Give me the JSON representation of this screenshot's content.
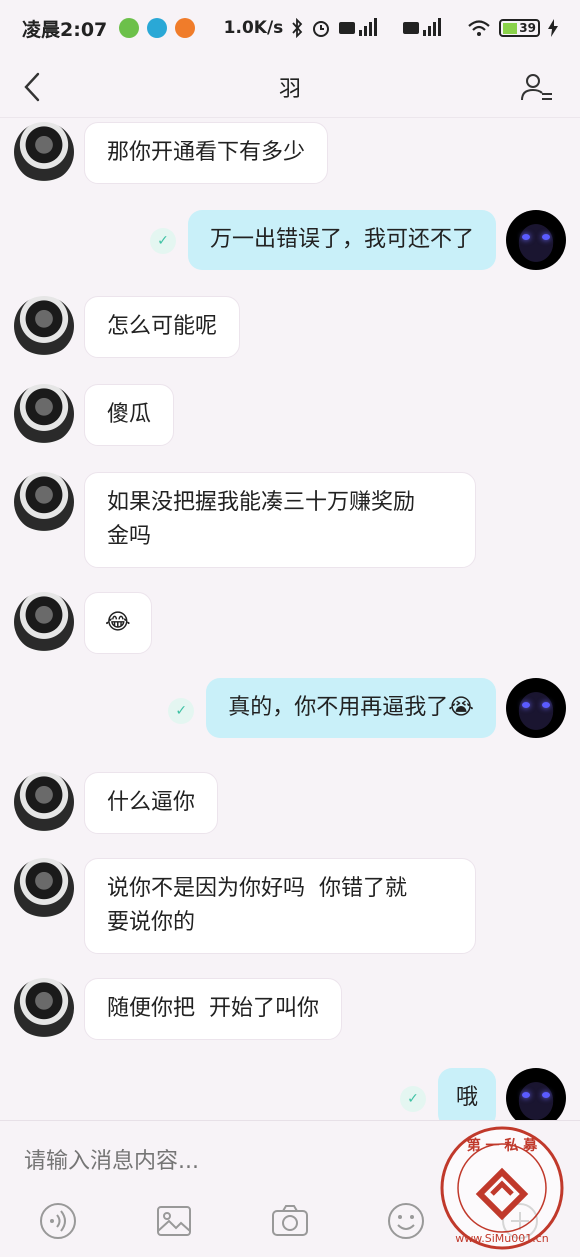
{
  "status": {
    "time": "凌晨2:07",
    "speed": "1.0K/s",
    "battery": "39"
  },
  "header": {
    "title": "羽"
  },
  "messages": [
    {
      "side": "in",
      "text": "那你开通看下有多少"
    },
    {
      "side": "out",
      "text": "万一出错误了，我可还不了"
    },
    {
      "side": "in",
      "text": "怎么可能呢"
    },
    {
      "side": "in",
      "text": "傻瓜"
    },
    {
      "side": "in",
      "text": "如果没把握我能凑三十万赚奖励\n金吗"
    },
    {
      "side": "in",
      "text": "😂"
    },
    {
      "side": "out",
      "text": "真的，你不用再逼我了😭"
    },
    {
      "side": "in",
      "text": "什么逼你"
    },
    {
      "side": "in",
      "text": "说你不是因为你好吗  你错了就\n要说你的"
    },
    {
      "side": "in",
      "text": "随便你把  开始了叫你"
    },
    {
      "side": "out",
      "text": "哦"
    }
  ],
  "input": {
    "placeholder": "请输入消息内容..."
  },
  "watermark": {
    "text_top": "第 一 私 募",
    "text_bottom": "www.SiMu001.cn",
    "color": "#c0392b"
  }
}
